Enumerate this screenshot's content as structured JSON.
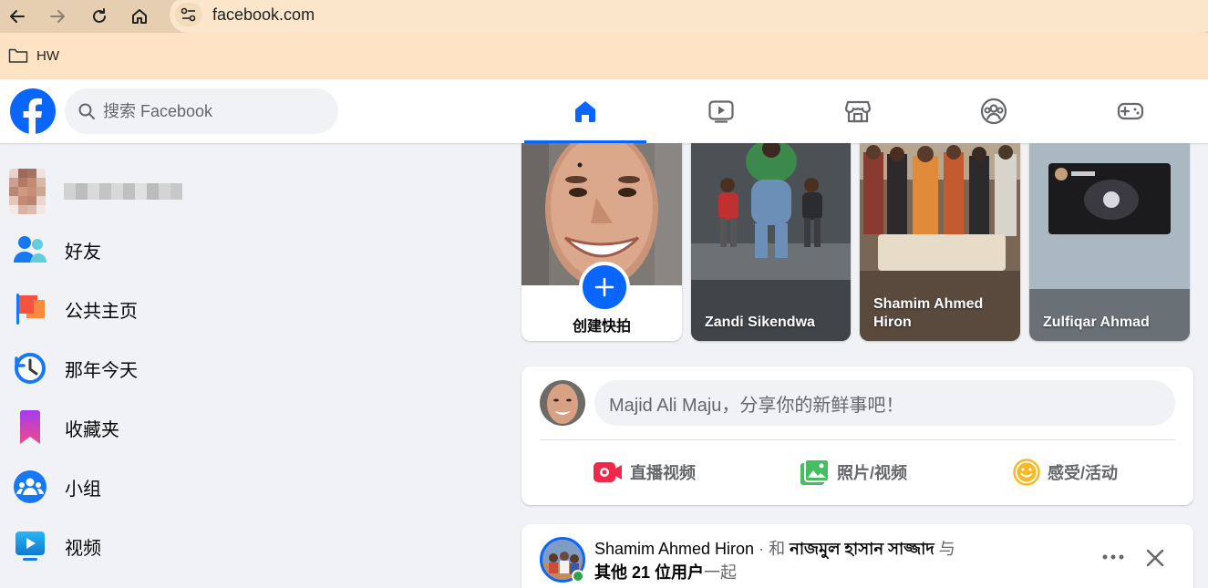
{
  "browser": {
    "url": "facebook.com",
    "bookmark_label": "HW"
  },
  "header": {
    "search_placeholder": "搜索 Facebook",
    "tabs": [
      "home",
      "watch",
      "marketplace",
      "groups",
      "gaming"
    ],
    "accent": "#0866ff"
  },
  "sidebar": {
    "items": [
      {
        "label": "好友",
        "icon": "friends-icon"
      },
      {
        "label": "公共主页",
        "icon": "pages-flag-icon"
      },
      {
        "label": "那年今天",
        "icon": "memories-clock-icon"
      },
      {
        "label": "收藏夹",
        "icon": "saved-bookmark-icon"
      },
      {
        "label": "小组",
        "icon": "groups-icon"
      },
      {
        "label": "视频",
        "icon": "video-icon"
      }
    ]
  },
  "stories": {
    "create_label": "创建快拍",
    "items": [
      {
        "name": "Zandi Sikendwa"
      },
      {
        "name": "Shamim Ahmed Hiron"
      },
      {
        "name": "Zulfiqar Ahmad"
      }
    ]
  },
  "composer": {
    "placeholder": "Majid Ali Maju，分享你的新鲜事吧！",
    "actions": [
      {
        "label": "直播视频",
        "color": "#f02849"
      },
      {
        "label": "照片/视频",
        "color": "#45bd62"
      },
      {
        "label": "感受/活动",
        "color": "#f7b928"
      }
    ]
  },
  "post": {
    "author": "Shamim Ahmed Hiron",
    "sep": " · 和 ",
    "with_name": "নাজমুল হাসান সাজ্জাদ",
    "and_text": " 与",
    "others": "其他 21 位用户",
    "together": "一起"
  }
}
